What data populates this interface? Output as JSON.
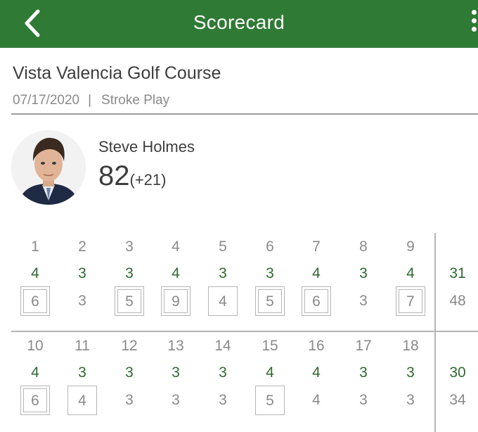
{
  "header": {
    "title": "Scorecard",
    "back_icon": "chevron-left-icon",
    "menu_icon": "more-vertical-icon",
    "color": "#2f7a35"
  },
  "course": {
    "name": "Vista Valencia Golf Course",
    "date": "07/17/2020",
    "separator": "|",
    "format": "Stroke Play"
  },
  "player": {
    "name": "Steve Holmes",
    "total": "82",
    "relative": "(+21)"
  },
  "front_nine": {
    "holes": [
      "1",
      "2",
      "3",
      "4",
      "5",
      "6",
      "7",
      "8",
      "9"
    ],
    "pars": [
      "4",
      "3",
      "3",
      "4",
      "3",
      "3",
      "4",
      "3",
      "4"
    ],
    "scores": [
      "6",
      "3",
      "5",
      "9",
      "4",
      "5",
      "6",
      "3",
      "7"
    ],
    "par_total": "31",
    "score_total": "48"
  },
  "back_nine": {
    "holes": [
      "10",
      "11",
      "12",
      "13",
      "14",
      "15",
      "16",
      "17",
      "18"
    ],
    "pars": [
      "4",
      "3",
      "3",
      "3",
      "3",
      "4",
      "4",
      "3",
      "3"
    ],
    "scores": [
      "6",
      "4",
      "3",
      "3",
      "3",
      "5",
      "4",
      "3",
      "3"
    ],
    "par_total": "30",
    "score_total": "34"
  },
  "colors": {
    "par": "#2f6a30",
    "muted": "#8a8a8a"
  }
}
